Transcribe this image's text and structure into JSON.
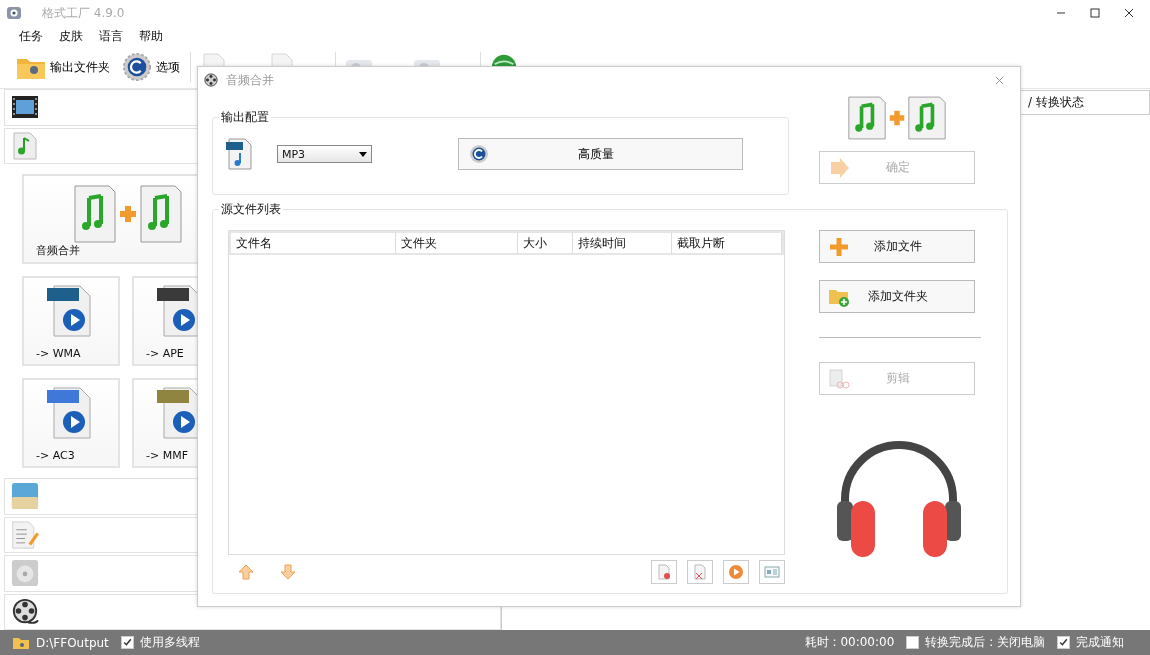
{
  "window": {
    "title": "格式工厂 4.9.0"
  },
  "menu": [
    "任务",
    "皮肤",
    "语言",
    "帮助"
  ],
  "toolbar": [
    {
      "label": "输出文件夹",
      "kind": "folder"
    },
    {
      "label": "选项",
      "kind": "options"
    }
  ],
  "sidebar": {
    "categories": [
      {
        "kind": "video",
        "expanded": false
      },
      {
        "kind": "audio",
        "expanded": true,
        "tiles": [
          {
            "label": "音频合并",
            "kind": "merge"
          },
          {
            "label": "-> WMA",
            "kind": "wma"
          },
          {
            "label": "-> APE",
            "kind": "ape"
          },
          {
            "label": "-> AC3",
            "kind": "aac"
          },
          {
            "label": "-> MMF",
            "kind": "mmf"
          }
        ]
      },
      {
        "kind": "picture",
        "expanded": false
      },
      {
        "kind": "document",
        "expanded": false
      },
      {
        "kind": "disc",
        "expanded": false
      },
      {
        "kind": "tools",
        "expanded": false
      }
    ]
  },
  "task_list": {
    "column_header": "/ 转换状态"
  },
  "dialog": {
    "title": "音频合并",
    "output_config": {
      "legend": "输出配置",
      "format": "MP3",
      "quality_button": "高质量"
    },
    "confirm_button": {
      "label": "确定",
      "disabled": true
    },
    "source_files": {
      "legend": "源文件列表",
      "columns": [
        "文件名",
        "文件夹",
        "大小",
        "持续时间",
        "截取片断"
      ]
    },
    "side_buttons": [
      {
        "label": "添加文件",
        "kind": "add",
        "disabled": false
      },
      {
        "label": "添加文件夹",
        "kind": "folder",
        "disabled": false
      },
      {
        "label": "剪辑",
        "kind": "clip",
        "disabled": true
      }
    ]
  },
  "status_bar": {
    "output_path": "D:\\FFOutput",
    "multithread": {
      "label": "使用多线程",
      "checked": true
    },
    "elapsed": "耗时 : 00:00:00",
    "shutdown": {
      "label": "转换完成后 : 关闭电脑",
      "checked": false
    },
    "notify": {
      "label": "完成通知",
      "checked": true
    }
  }
}
